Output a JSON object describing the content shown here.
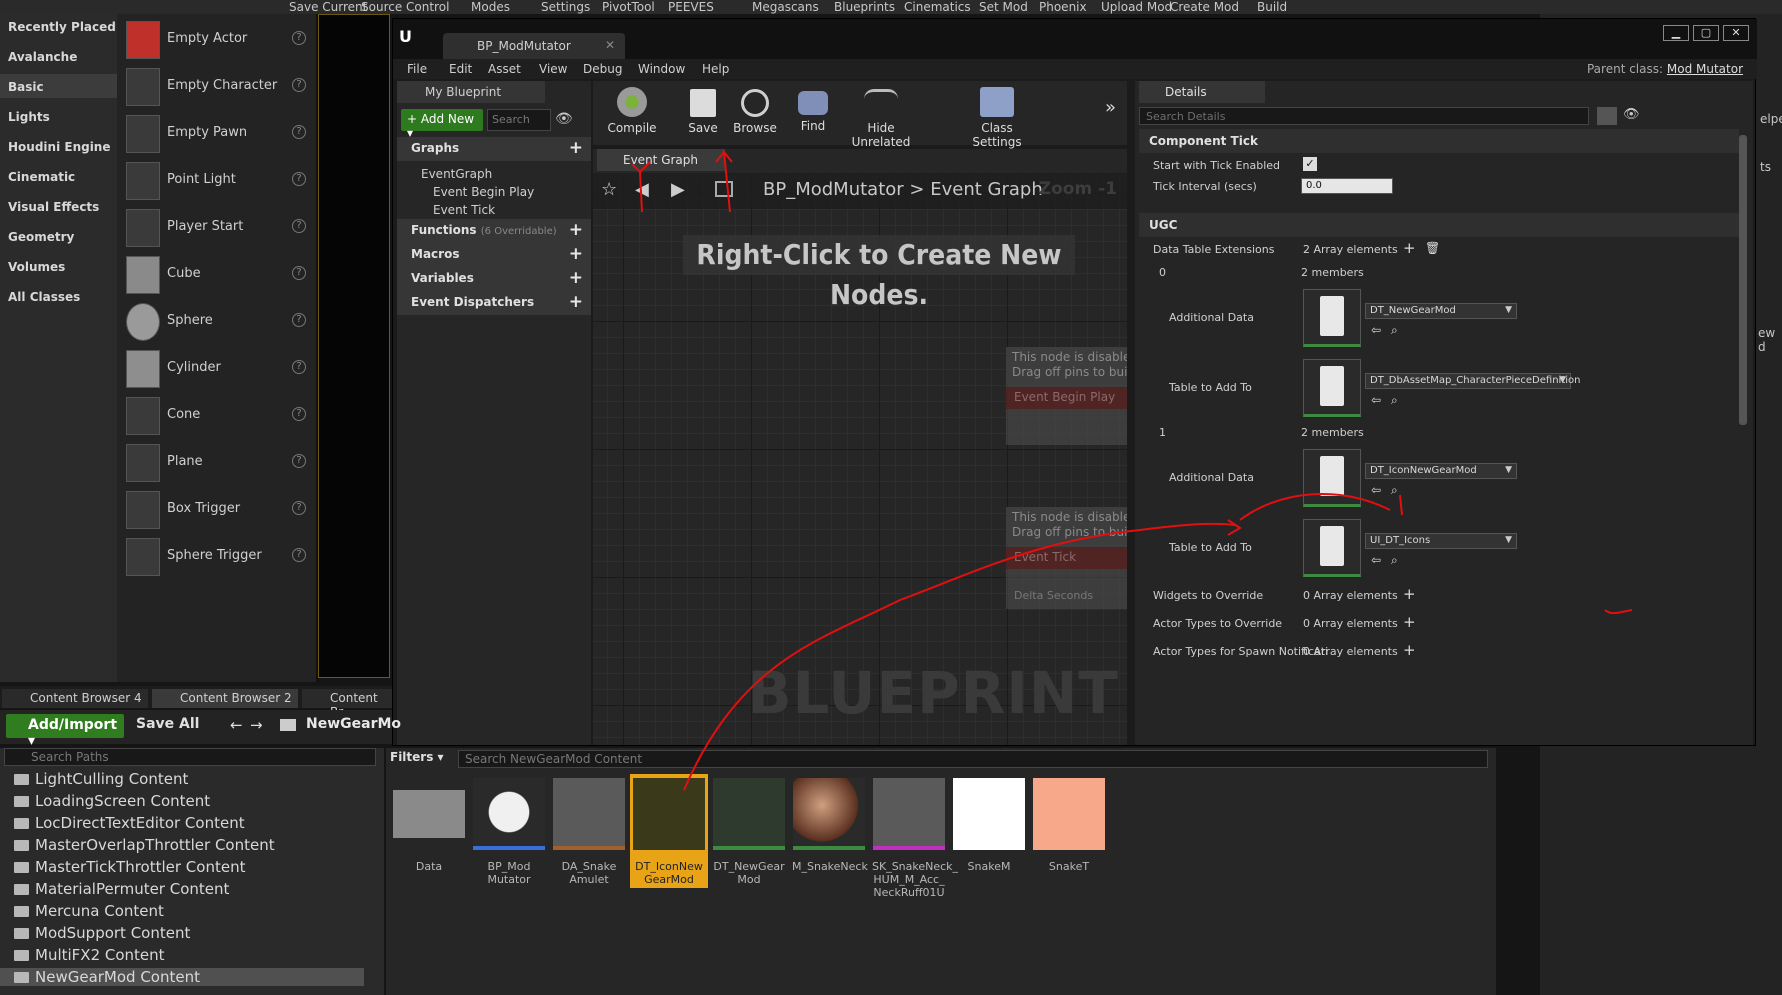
{
  "top_menu": [
    "Save Current",
    "Source Control",
    "Modes",
    "Settings",
    "PivotTool",
    "PEEVES",
    "Megascans",
    "Blueprints",
    "Cinematics",
    "Set Mod",
    "Phoenix",
    "Upload Mod",
    "Create Mod",
    "Build"
  ],
  "place_categories": [
    "Recently Placed",
    "Avalanche",
    "Basic",
    "Lights",
    "Houdini Engine",
    "Cinematic",
    "Visual Effects",
    "Geometry",
    "Volumes",
    "All Classes"
  ],
  "place_items": [
    "Empty Actor",
    "Empty Character",
    "Empty Pawn",
    "Point Light",
    "Player Start",
    "Cube",
    "Sphere",
    "Cylinder",
    "Cone",
    "Plane",
    "Box Trigger",
    "Sphere Trigger"
  ],
  "bp": {
    "tab_title": "BP_ModMutator",
    "menu": [
      "File",
      "Edit",
      "Asset",
      "View",
      "Debug",
      "Window",
      "Help"
    ],
    "parent_class_label": "Parent class:",
    "parent_class_value": "Mod Mutator",
    "my_blueprint_tab": "My Blueprint",
    "add_new": "+ Add New ▾",
    "search_placeholder": "Search",
    "graphs_label": "Graphs",
    "event_graph": "EventGraph",
    "event_begin_play": "Event Begin Play",
    "event_tick": "Event Tick",
    "functions_label": "Functions",
    "functions_sub": "(6 Overridable)",
    "macros_label": "Macros",
    "variables_label": "Variables",
    "dispatchers_label": "Event Dispatchers",
    "toolbar": [
      "Compile",
      "Save",
      "Browse",
      "Find",
      "Hide Unrelated",
      "Class Settings"
    ],
    "graph_tab": "Event Graph",
    "breadcrumb_bp": "BP_ModMutator",
    "breadcrumb_sep": ">",
    "breadcrumb_graph": "Event Graph",
    "zoom": "Zoom -1",
    "hint": "Right-Click to Create New Nodes.",
    "watermark": "BLUEPRINT",
    "disabled_msg_1": "This node is disabled and will",
    "disabled_msg_2": "Drag off pins to build function",
    "node_begin": "Event Begin Play",
    "node_tick": "Event Tick",
    "delta_seconds": "Delta Seconds"
  },
  "details": {
    "tab": "Details",
    "search_placeholder": "Search Details",
    "component_tick": "Component Tick",
    "start_tick_label": "Start with Tick Enabled",
    "tick_interval_label": "Tick Interval (secs)",
    "tick_interval_value": "0.0",
    "ugc": "UGC",
    "dte_label": "Data Table Extensions",
    "dte_value": "2 Array elements",
    "idx0": "0",
    "idx1": "1",
    "members": "2 members",
    "additional_data": "Additional Data",
    "table_to_add": "Table to Add To",
    "dt0_add": "DT_NewGearMod",
    "dt0_table": "DT_DbAssetMap_CharacterPieceDefinition",
    "dt1_add": "DT_IconNewGearMod",
    "dt1_table": "UI_DT_Icons",
    "widgets_label": "Widgets to Override",
    "actor_types_label": "Actor Types to Override",
    "actor_spawn_label": "Actor Types for Spawn Notificati",
    "zero_elements": "0 Array elements"
  },
  "cb": {
    "tabs": [
      "Content Browser 4",
      "Content Browser 2",
      "Content Br"
    ],
    "add_import": "Add/Import ▾",
    "save_all": "Save All",
    "path": "NewGearMo",
    "search_paths": "Search Paths",
    "folders": [
      "LightCulling Content",
      "LoadingScreen Content",
      "LocDirectTextEditor Content",
      "MasterOverlapThrottler Content",
      "MasterTickThrottler Content",
      "MaterialPermuter Content",
      "Mercuna Content",
      "ModSupport Content",
      "MultiFX2 Content",
      "NewGearMod Content"
    ],
    "filters": "Filters ▾",
    "asset_search": "Search NewGearMod Content",
    "assets": [
      "Data",
      "BP_Mod Mutator",
      "DA_Snake Amulet",
      "DT_IconNew GearMod",
      "DT_NewGear Mod",
      "M_SnakeNeck",
      "SK_SnakeNeck_ HUM_M_Acc_ NeckRuff01U",
      "SnakeM",
      "SnakeT"
    ]
  },
  "right_fragments": [
    "elper",
    "ts",
    "ew d"
  ],
  "colors": {
    "accent_green": "#2f7d1f",
    "annotation_red": "#e01010",
    "selected_asset": "#e8a317"
  }
}
